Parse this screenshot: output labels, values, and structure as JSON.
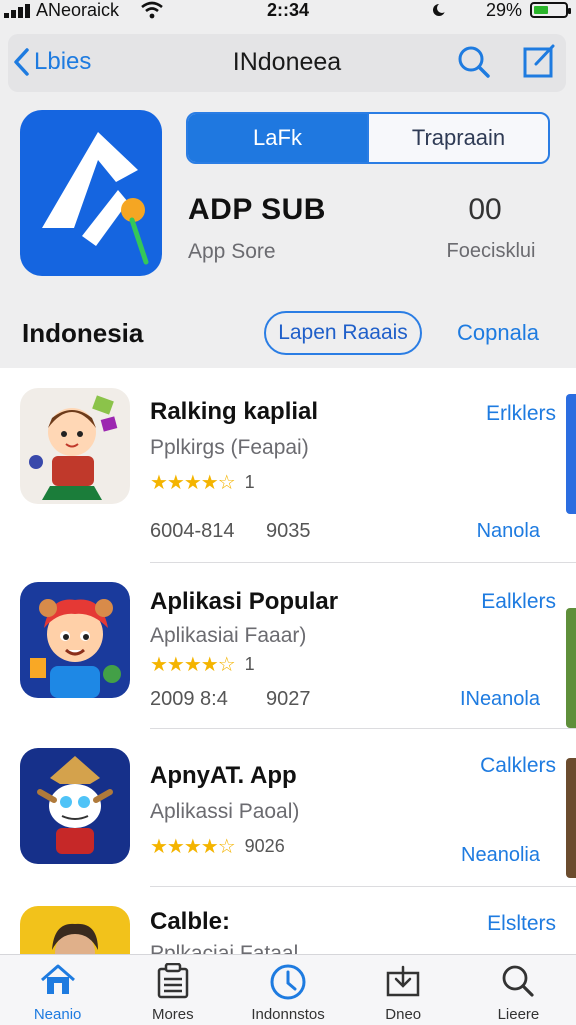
{
  "status": {
    "carrier": "ANeoraick",
    "time": "2::34",
    "battery": "29%"
  },
  "nav": {
    "back_label": "Lbies",
    "title": "INdoneea"
  },
  "app": {
    "segment_active": "LaFk",
    "segment_inactive": "Trapraain",
    "title": "ADP SUB",
    "subtitle": "App Sore",
    "rating_value": "00",
    "rating_label": "Foecisklui"
  },
  "section": {
    "title": "Indonesia",
    "pill_label": "Lapen Raaais",
    "link": "Copnala"
  },
  "list": [
    {
      "name": "Ralking kaplial",
      "desc": "Pplkirgs (Feapai)",
      "stars": "★★★★☆",
      "count": "1",
      "meta1": "6004-814",
      "meta2": "9035",
      "action": "Erlklers",
      "sub": "Nanola"
    },
    {
      "name": "Aplikasi Popular",
      "desc": "Aplikasiai Faaar)",
      "stars": "★★★★☆",
      "count": "1",
      "meta1": "2009 8:4",
      "meta2": "9027",
      "action": "Ealklers",
      "sub": "INeanola"
    },
    {
      "name": "ApnyAT. App",
      "desc": "Aplikassi Paoal)",
      "stars": "★★★★☆",
      "count": "9026",
      "action": "Calklers",
      "sub": "Neanolia"
    },
    {
      "name": "Calble:",
      "desc": "Pplkaciai Fataal",
      "action": "Elslters"
    }
  ],
  "tabs": [
    {
      "label": "Neanio"
    },
    {
      "label": "Mores"
    },
    {
      "label": "Indonnstos"
    },
    {
      "label": "Dneo"
    },
    {
      "label": "Lieere"
    }
  ],
  "colors": {
    "accent": "#1e7be0",
    "star": "#f4b400",
    "app_icon": "#1565e0"
  }
}
